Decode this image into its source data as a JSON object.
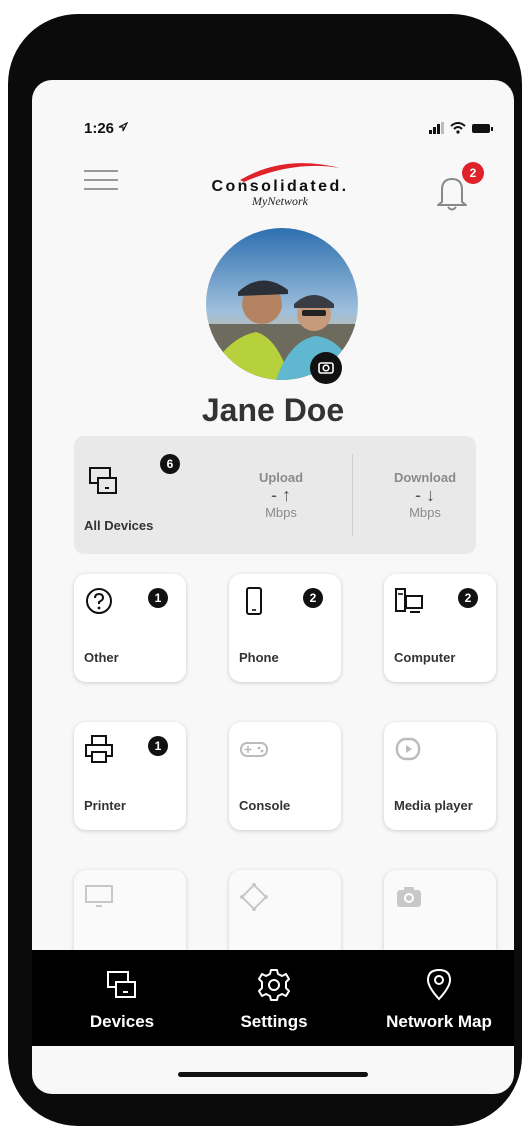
{
  "status": {
    "time": "1:26",
    "location_icon": "location-arrow-icon"
  },
  "header": {
    "brand": "Consolidated.",
    "subtitle": "MyNetwork",
    "notification_count": "2"
  },
  "profile": {
    "name": "Jane Doe"
  },
  "summary": {
    "all_devices_label": "All Devices",
    "all_devices_count": "6",
    "upload_label": "Upload",
    "upload_value": "-",
    "upload_unit": "Mbps",
    "download_label": "Download",
    "download_value": "-",
    "download_unit": "Mbps"
  },
  "categories": [
    {
      "label": "Other",
      "count": "1",
      "icon": "question-circle-icon"
    },
    {
      "label": "Phone",
      "count": "2",
      "icon": "phone-icon"
    },
    {
      "label": "Computer",
      "count": "2",
      "icon": "computer-icon"
    },
    {
      "label": "Printer",
      "count": "1",
      "icon": "printer-icon"
    },
    {
      "label": "Console",
      "count": "",
      "icon": "gamepad-icon"
    },
    {
      "label": "Media player",
      "count": "",
      "icon": "media-player-icon"
    },
    {
      "label": "",
      "count": "",
      "icon": "monitor-icon"
    },
    {
      "label": "",
      "count": "",
      "icon": "smart-hub-icon"
    },
    {
      "label": "",
      "count": "",
      "icon": "camera-icon"
    }
  ],
  "nav": [
    {
      "label": "Devices",
      "icon": "devices-icon"
    },
    {
      "label": "Settings",
      "icon": "gear-icon"
    },
    {
      "label": "Network Map",
      "icon": "map-pin-icon"
    }
  ],
  "colors": {
    "brand_red": "#e0222a",
    "nav_bg": "#000000",
    "summary_bg": "#e9e9e9"
  }
}
